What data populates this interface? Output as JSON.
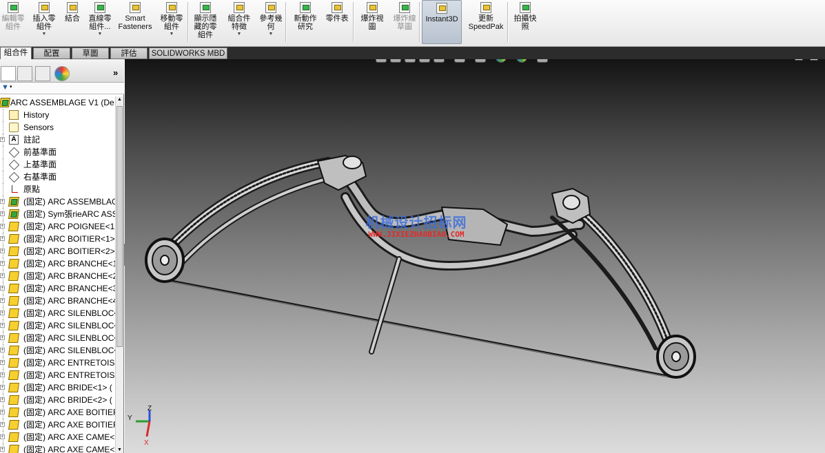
{
  "ribbon": {
    "buttons": [
      {
        "label": "編輯零\n組件",
        "icon": "edit-component-icon",
        "disabled": true,
        "dropdown": false
      },
      {
        "label": "插入零\n組件",
        "icon": "insert-components-icon",
        "disabled": false,
        "dropdown": true
      },
      {
        "label": "結合",
        "icon": "mate-icon",
        "disabled": false,
        "dropdown": false
      },
      {
        "label": "直線零\n組件...",
        "icon": "linear-pattern-icon",
        "disabled": false,
        "dropdown": true
      },
      {
        "label": "Smart\nFasteners",
        "icon": "smart-fasteners-icon",
        "disabled": false,
        "dropdown": false
      },
      {
        "label": "移動零\n組件",
        "icon": "move-component-icon",
        "disabled": false,
        "dropdown": true
      },
      {
        "label": "顯示隱\n藏的零\n組件",
        "icon": "show-hidden-icon",
        "disabled": false,
        "dropdown": false
      },
      {
        "label": "組合件\n特徵",
        "icon": "assembly-features-icon",
        "disabled": false,
        "dropdown": true
      },
      {
        "label": "參考幾\n何",
        "icon": "reference-geometry-icon",
        "disabled": false,
        "dropdown": true
      },
      {
        "label": "新動作\n研究",
        "icon": "motion-study-icon",
        "disabled": false,
        "dropdown": false
      },
      {
        "label": "零件表",
        "icon": "bom-icon",
        "disabled": false,
        "dropdown": false
      },
      {
        "label": "爆炸視\n圖",
        "icon": "exploded-view-icon",
        "disabled": false,
        "dropdown": false
      },
      {
        "label": "爆炸線\n草圖",
        "icon": "explode-line-sketch-icon",
        "disabled": true,
        "dropdown": false
      },
      {
        "label": "Instant3D",
        "icon": "instant3d-icon",
        "disabled": false,
        "dropdown": false
      },
      {
        "label": "更新\nSpeedPak",
        "icon": "speedpak-icon",
        "disabled": false,
        "dropdown": false
      },
      {
        "label": "拍攝快\n照",
        "icon": "snapshot-icon",
        "disabled": false,
        "dropdown": false
      }
    ]
  },
  "tabs": [
    "組合件",
    "配置",
    "草圖",
    "評估",
    "SOLIDWORKS MBD"
  ],
  "tree": {
    "root": "ARC ASSEMBLAGE V1  (De",
    "items": [
      {
        "label": "History",
        "icon": "history-icon",
        "expander": false
      },
      {
        "label": "Sensors",
        "icon": "sensors-icon",
        "expander": false
      },
      {
        "label": "註記",
        "icon": "annotations-icon",
        "expander": true
      },
      {
        "label": "前基準面",
        "icon": "plane-icon",
        "expander": false
      },
      {
        "label": "上基準面",
        "icon": "plane-icon",
        "expander": false
      },
      {
        "label": "右基準面",
        "icon": "plane-icon",
        "expander": false
      },
      {
        "label": "原點",
        "icon": "origin-icon",
        "expander": false
      },
      {
        "label": "(固定) ARC ASSEMBLAG",
        "icon": "subassembly-icon",
        "expander": true
      },
      {
        "label": "(固定) Sym張rieARC ASS",
        "icon": "subassembly-icon",
        "expander": true
      },
      {
        "label": "(固定) ARC POIGNEE<1",
        "icon": "part-icon",
        "expander": true
      },
      {
        "label": "(固定) ARC BOITIER<1>",
        "icon": "part-icon",
        "expander": true
      },
      {
        "label": "(固定) ARC BOITIER<2>",
        "icon": "part-icon",
        "expander": true
      },
      {
        "label": "(固定) ARC BRANCHE<1",
        "icon": "part-icon",
        "expander": true
      },
      {
        "label": "(固定) ARC BRANCHE<2",
        "icon": "part-icon",
        "expander": true
      },
      {
        "label": "(固定) ARC BRANCHE<3",
        "icon": "part-icon",
        "expander": true
      },
      {
        "label": "(固定) ARC BRANCHE<4",
        "icon": "part-icon",
        "expander": true
      },
      {
        "label": "(固定) ARC SILENBLOC<",
        "icon": "part-icon",
        "expander": true
      },
      {
        "label": "(固定) ARC SILENBLOC<",
        "icon": "part-icon",
        "expander": true
      },
      {
        "label": "(固定) ARC SILENBLOC<",
        "icon": "part-icon",
        "expander": true
      },
      {
        "label": "(固定) ARC SILENBLOC<",
        "icon": "part-icon",
        "expander": true
      },
      {
        "label": "(固定) ARC ENTRETOISE",
        "icon": "part-icon",
        "expander": true
      },
      {
        "label": "(固定) ARC ENTRETOISE",
        "icon": "part-icon",
        "expander": true
      },
      {
        "label": "(固定) ARC BRIDE<1> (",
        "icon": "part-icon",
        "expander": true
      },
      {
        "label": "(固定) ARC BRIDE<2> (",
        "icon": "part-icon",
        "expander": true
      },
      {
        "label": "(固定) ARC AXE BOITIER",
        "icon": "part-icon",
        "expander": true
      },
      {
        "label": "(固定) ARC AXE BOITIER",
        "icon": "part-icon",
        "expander": true
      },
      {
        "label": "(固定) ARC AXE CAME<",
        "icon": "part-icon",
        "expander": true
      },
      {
        "label": "(固定) ARC AXE CAME<",
        "icon": "part-icon",
        "expander": true
      }
    ]
  },
  "watermark": {
    "title": "机械设计招标网",
    "url": "WWW.JIXIEZHAOBIAO.COM"
  },
  "triad": {
    "x": "X",
    "y": "Y",
    "z": "Z"
  },
  "viewport": {
    "heads_up_icons": [
      "zoom-to-fit-icon",
      "zoom-area-icon",
      "previous-view-icon",
      "section-view-icon",
      "view-orientation-icon",
      "display-style-icon",
      "hide-show-icon",
      "edit-appearance-icon",
      "apply-scene-icon",
      "view-settings-icon"
    ]
  }
}
